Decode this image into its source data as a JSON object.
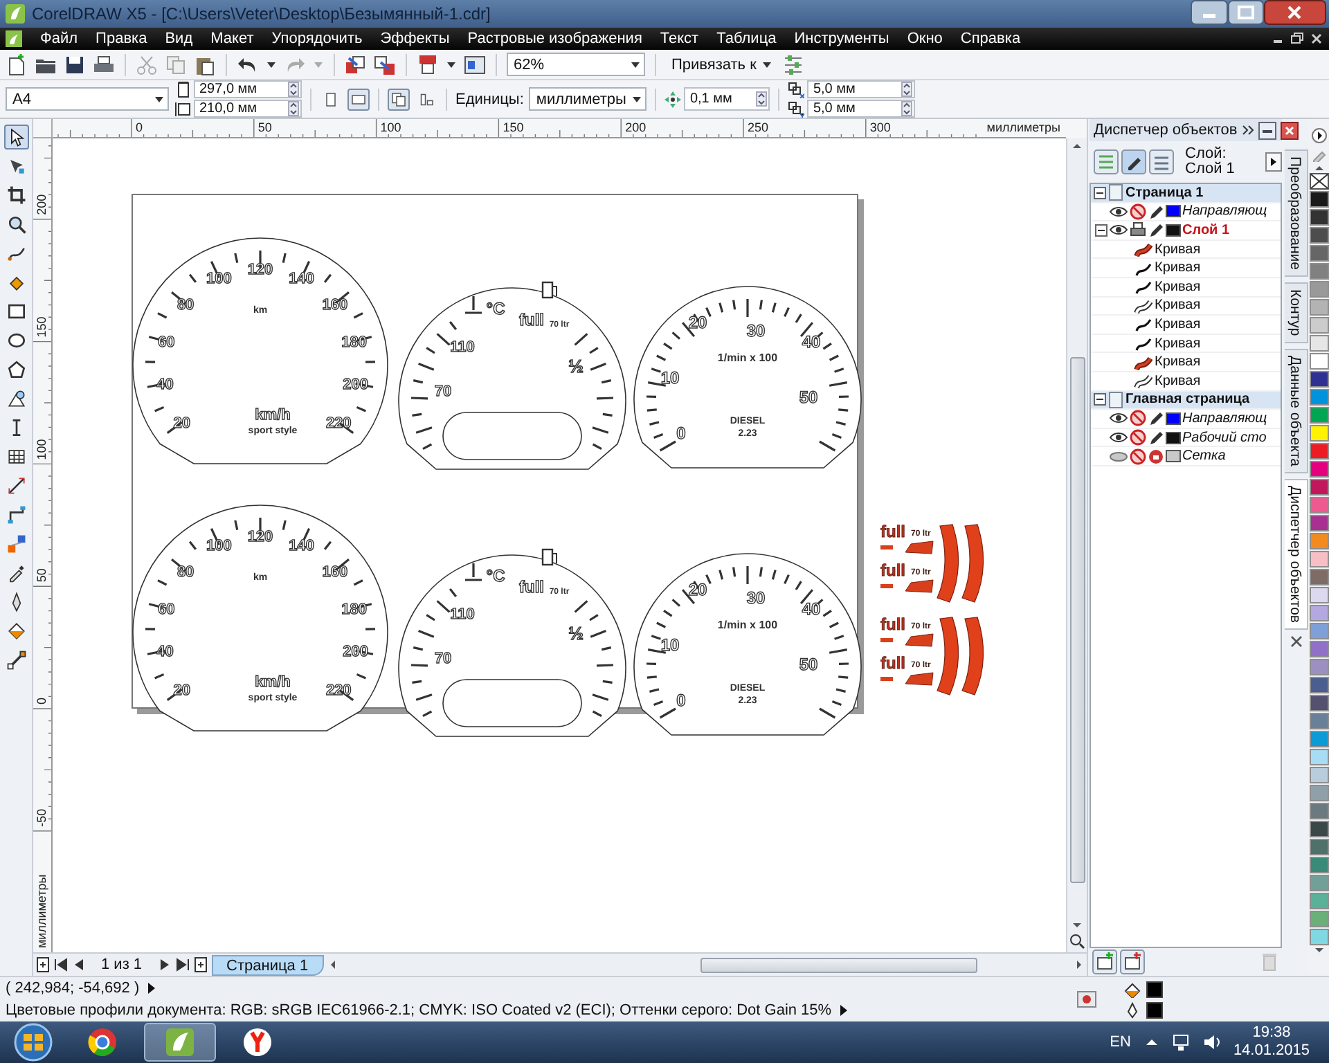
{
  "window": {
    "title": "CorelDRAW X5 - [C:\\Users\\Veter\\Desktop\\Безымянный-1.cdr]"
  },
  "menu": [
    "Файл",
    "Правка",
    "Вид",
    "Макет",
    "Упорядочить",
    "Эффекты",
    "Растровые изображения",
    "Текст",
    "Таблица",
    "Инструменты",
    "Окно",
    "Справка"
  ],
  "toolbar": {
    "zoom": "62%",
    "snap": "Привязать к"
  },
  "property_bar": {
    "paper": "A4",
    "width": "297,0 мм",
    "height": "210,0 мм",
    "orientations": [
      {
        "kind": "portrait",
        "selected": false
      },
      {
        "kind": "landscape",
        "selected": true
      }
    ],
    "page_scope": [
      {
        "kind": "all_pages",
        "selected": true
      },
      {
        "kind": "current_page",
        "selected": false
      }
    ],
    "units_label": "Единицы:",
    "units": "миллиметры",
    "nudge": "0,1 мм",
    "duplicate_x": "5,0 мм",
    "duplicate_y": "5,0 мм"
  },
  "tools": [
    {
      "kind": "pointer",
      "selected": true
    },
    {
      "kind": "shape",
      "selected": false
    },
    {
      "kind": "crop",
      "selected": false
    },
    {
      "kind": "zoom",
      "selected": false
    },
    {
      "kind": "freehand",
      "selected": false
    },
    {
      "kind": "smart_fill",
      "selected": false
    },
    {
      "kind": "rectangle",
      "selected": false
    },
    {
      "kind": "ellipse",
      "selected": false
    },
    {
      "kind": "polygon",
      "selected": false
    },
    {
      "kind": "basic_shapes",
      "selected": false
    },
    {
      "kind": "text",
      "selected": false
    },
    {
      "kind": "table",
      "selected": false
    },
    {
      "kind": "dimension",
      "selected": false
    },
    {
      "kind": "connector",
      "selected": false
    },
    {
      "kind": "blend",
      "selected": false
    },
    {
      "kind": "eyedropper",
      "selected": false
    },
    {
      "kind": "outline",
      "selected": false
    },
    {
      "kind": "fill",
      "selected": false
    },
    {
      "kind": "interactive_fill",
      "selected": false
    }
  ],
  "ruler_h": {
    "labels": [
      "0",
      "50",
      "100",
      "150",
      "200",
      "250",
      "300"
    ],
    "unit": "миллиметры"
  },
  "ruler_v": {
    "labels": [
      "200",
      "150",
      "100",
      "50",
      "0",
      "-50"
    ],
    "unit": "миллиметры"
  },
  "gauges": [
    {
      "kind": "speedometer",
      "scale": [
        "20",
        "40",
        "60",
        "80",
        "100",
        "120",
        "140",
        "160",
        "180",
        "200",
        "220"
      ],
      "texts": [
        "km",
        "km/h",
        "sport style"
      ]
    },
    {
      "kind": "temp_fuel",
      "scale": [
        "70",
        "110"
      ],
      "texts": [
        "°C",
        "full",
        "70 ltr",
        "½"
      ]
    },
    {
      "kind": "tachometer",
      "scale": [
        "0",
        "10",
        "20",
        "30",
        "40",
        "50"
      ],
      "texts": [
        "1/min x 100",
        "DIESEL",
        "2.23"
      ]
    },
    {
      "kind": "speedometer",
      "scale": [
        "20",
        "40",
        "60",
        "80",
        "100",
        "120",
        "140",
        "160",
        "180",
        "200",
        "220"
      ],
      "texts": [
        "km",
        "km/h",
        "sport style"
      ]
    },
    {
      "kind": "temp_fuel",
      "scale": [
        "70",
        "110"
      ],
      "texts": [
        "°C",
        "full",
        "70 ltr",
        "½"
      ]
    },
    {
      "kind": "tachometer",
      "scale": [
        "0",
        "10",
        "20",
        "30",
        "40",
        "50"
      ],
      "texts": [
        "1/min x 100",
        "DIESEL",
        "2.23"
      ]
    }
  ],
  "decals": [
    {
      "word": "full",
      "volume": "70 ltr"
    },
    {
      "word": "full",
      "volume": "70 ltr"
    },
    {
      "word": "full",
      "volume": "70 ltr"
    },
    {
      "word": "full",
      "volume": "70 ltr"
    }
  ],
  "object_manager": {
    "title": "Диспетчер объектов",
    "layer_label": "Слой:",
    "current_layer": "Слой 1",
    "pages": [
      {
        "name": "Страница 1",
        "expanded": true,
        "layers": [
          {
            "kind": "guides",
            "name": "Направляющ",
            "color": "#0000ff",
            "visible": true,
            "printable": false,
            "editable": true,
            "active": false
          },
          {
            "kind": "layer",
            "name": "Слой 1",
            "color": "#111111",
            "visible": true,
            "printable": true,
            "editable": true,
            "active": true,
            "expanded": true,
            "children": [
              {
                "kind": "filled",
                "name": "Кривая"
              },
              {
                "kind": "line",
                "name": "Кривая"
              },
              {
                "kind": "line",
                "name": "Кривая"
              },
              {
                "kind": "outline",
                "name": "Кривая"
              },
              {
                "kind": "line",
                "name": "Кривая"
              },
              {
                "kind": "line",
                "name": "Кривая"
              },
              {
                "kind": "filled",
                "name": "Кривая"
              },
              {
                "kind": "outline",
                "name": "Кривая"
              }
            ]
          }
        ]
      },
      {
        "name": "Главная страница",
        "expanded": true,
        "layers": [
          {
            "kind": "guides",
            "name": "Направляющ",
            "color": "#0000ff",
            "visible": true,
            "printable": false,
            "editable": true,
            "active": false
          },
          {
            "kind": "desktop",
            "name": "Рабочий сто",
            "color": "#111111",
            "visible": true,
            "printable": false,
            "editable": true,
            "active": false
          },
          {
            "kind": "grid",
            "name": "Сетка",
            "color": "#c8c8c8",
            "visible": false,
            "printable": false,
            "editable": false,
            "active": false
          }
        ]
      }
    ]
  },
  "docker_tabs": [
    {
      "label": "Преобразование",
      "selected": false
    },
    {
      "label": "Контур",
      "selected": false
    },
    {
      "label": "Данные объекта",
      "selected": false
    },
    {
      "label": "Диспетчер объектов",
      "selected": true
    }
  ],
  "palette": [
    {
      "color": "#1a1a1a"
    },
    {
      "color": "#333333"
    },
    {
      "color": "#4d4d4d"
    },
    {
      "color": "#666666"
    },
    {
      "color": "#808080"
    },
    {
      "color": "#999999"
    },
    {
      "color": "#b3b3b3"
    },
    {
      "color": "#cccccc"
    },
    {
      "color": "#e6e6e6"
    },
    {
      "color": "#ffffff"
    },
    {
      "color": "#2e3192"
    },
    {
      "color": "#0093dd"
    },
    {
      "color": "#00a651"
    },
    {
      "color": "#fff200"
    },
    {
      "color": "#ed1c24"
    },
    {
      "color": "#e4007f"
    },
    {
      "color": "#c2185b"
    },
    {
      "color": "#ef5a8e"
    },
    {
      "color": "#a83090"
    },
    {
      "color": "#f38a1f"
    },
    {
      "color": "#f7bfc5"
    },
    {
      "color": "#7e6b66"
    },
    {
      "color": "#dcd8f0"
    },
    {
      "color": "#b4a8e0"
    },
    {
      "color": "#7f9fd8"
    },
    {
      "color": "#9070c8"
    },
    {
      "color": "#9c90c0"
    },
    {
      "color": "#4b5e90"
    },
    {
      "color": "#545070"
    },
    {
      "color": "#6a8098"
    },
    {
      "color": "#0c9bd6"
    },
    {
      "color": "#a8dcf4"
    },
    {
      "color": "#b8ccdc"
    },
    {
      "color": "#90a0a8"
    },
    {
      "color": "#6a7a80"
    },
    {
      "color": "#3a4848"
    },
    {
      "color": "#50706a"
    },
    {
      "color": "#3a8a78"
    },
    {
      "color": "#70a098"
    },
    {
      "color": "#5ab098"
    },
    {
      "color": "#6ab078"
    },
    {
      "color": "#80d8e0"
    }
  ],
  "page_nav": {
    "counter": "1 из 1",
    "tabs": [
      {
        "label": "Страница 1",
        "selected": true
      }
    ]
  },
  "status_bar": {
    "coordinates": "( 242,984; -54,692 )",
    "profiles": "Цветовые профили документа: RGB: sRGB IEC61966-2.1; CMYK: ISO Coated v2 (ECI); Оттенки серого: Dot Gain 15%"
  },
  "taskbar": {
    "apps": [
      {
        "kind": "chrome",
        "selected": false
      },
      {
        "kind": "coreldraw",
        "selected": true
      },
      {
        "kind": "yandex",
        "selected": false
      }
    ],
    "language": "EN",
    "time": "19:38",
    "date": "14.01.2015"
  }
}
